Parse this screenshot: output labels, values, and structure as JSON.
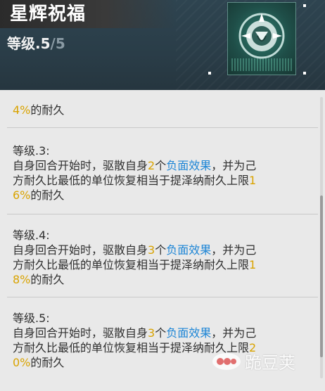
{
  "header": {
    "title": "星辉祝福",
    "level_prefix": "等级.5",
    "level_max": "/5",
    "icon": "star-blessing-skill-icon"
  },
  "entries": [
    {
      "lines": [
        [
          {
            "t": "4%",
            "c": "yellow"
          },
          {
            "t": "的耐久"
          }
        ]
      ]
    },
    {
      "heading": "等级.3:",
      "lines": [
        [
          {
            "t": "自身回合开始时，驱散自身"
          },
          {
            "t": "2",
            "c": "yellow"
          },
          {
            "t": "个"
          },
          {
            "t": "负面效果",
            "c": "blue"
          },
          {
            "t": "，并为己"
          }
        ],
        [
          {
            "t": "方耐久比最低的单位恢复相当于提泽纳耐久上限"
          },
          {
            "t": "1",
            "c": "yellow"
          }
        ],
        [
          {
            "t": "6%",
            "c": "yellow"
          },
          {
            "t": "的耐久"
          }
        ]
      ]
    },
    {
      "heading": "等级.4:",
      "lines": [
        [
          {
            "t": "自身回合开始时，驱散自身"
          },
          {
            "t": "3",
            "c": "yellow"
          },
          {
            "t": "个"
          },
          {
            "t": "负面效果",
            "c": "blue"
          },
          {
            "t": "，并为己"
          }
        ],
        [
          {
            "t": "方耐久比最低的单位恢复相当于提泽纳耐久上限"
          },
          {
            "t": "1",
            "c": "yellow"
          }
        ],
        [
          {
            "t": "8%",
            "c": "yellow"
          },
          {
            "t": "的耐久"
          }
        ]
      ]
    },
    {
      "heading": "等级.5:",
      "lines": [
        [
          {
            "t": "自身回合开始时，驱散自身"
          },
          {
            "t": "3",
            "c": "yellow"
          },
          {
            "t": "个"
          },
          {
            "t": "负面效果",
            "c": "blue"
          },
          {
            "t": "，并为己"
          }
        ],
        [
          {
            "t": "方耐久比最低的单位恢复相当于提泽纳耐久上限"
          },
          {
            "t": "2",
            "c": "yellow"
          }
        ],
        [
          {
            "t": "0%",
            "c": "yellow"
          },
          {
            "t": "的耐久"
          }
        ]
      ]
    }
  ],
  "colors": {
    "highlight_yellow": "#d9a300",
    "highlight_blue": "#1e86d6",
    "text": "#2f2f2f"
  },
  "watermark": {
    "text": "跪豆荚",
    "logo": "peapod-logo-icon"
  }
}
